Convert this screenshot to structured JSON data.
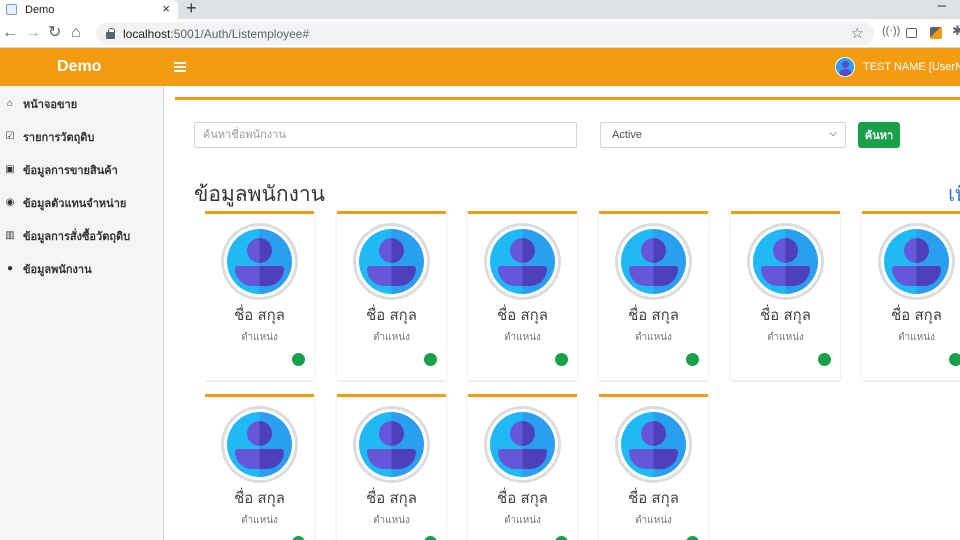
{
  "browser": {
    "tab_title": "Demo",
    "tab_close": "×",
    "new_tab": "+",
    "window_minimize": "–",
    "back": "←",
    "forward": "→",
    "reload": "↻",
    "home": "⌂",
    "url_host": "localhost",
    "url_path": ":5001/Auth/Listemployee#",
    "bookmark": "☆"
  },
  "navbar": {
    "brand": "Demo",
    "user_name": "TEST NAME [UserName]",
    "color": "#f39c12"
  },
  "sidebar": {
    "items": [
      {
        "icon": "home-icon",
        "label": "หน้าจอขาย"
      },
      {
        "icon": "check-square-icon",
        "label": "รายการวัตถุดิบ"
      },
      {
        "icon": "money-icon",
        "label": "ข้อมูลการขายสินค้า"
      },
      {
        "icon": "eye-icon",
        "label": "ข้อมูลตัวแทนจำหน่าย"
      },
      {
        "icon": "bar-chart-icon",
        "label": "ข้อมูลการสั่งซื้อวัตถุดิบ"
      },
      {
        "icon": "user-icon",
        "label": "ข้อมูลพนักงาน"
      }
    ]
  },
  "main": {
    "search_placeholder": "ค้นหาชื่อพนักงาน",
    "status_selected": "Active",
    "search_button": "ค้นหา",
    "section_title": "ข้อมูลพนักงาน",
    "more_link": "เพิ่ม",
    "employees": [
      {
        "name": "ชื่อ สกุล",
        "position": "ตำแหน่ง",
        "status": "active"
      },
      {
        "name": "ชื่อ สกุล",
        "position": "ตำแหน่ง",
        "status": "active"
      },
      {
        "name": "ชื่อ สกุล",
        "position": "ตำแหน่ง",
        "status": "active"
      },
      {
        "name": "ชื่อ สกุล",
        "position": "ตำแหน่ง",
        "status": "active"
      },
      {
        "name": "ชื่อ สกุล",
        "position": "ตำแหน่ง",
        "status": "active"
      },
      {
        "name": "ชื่อ สกุล",
        "position": "ตำแหน่ง",
        "status": "active"
      },
      {
        "name": "ชื่อ สกุล",
        "position": "ตำแหน่ง",
        "status": "active"
      },
      {
        "name": "ชื่อ สกุล",
        "position": "ตำแหน่ง",
        "status": "active"
      },
      {
        "name": "ชื่อ สกุล",
        "position": "ตำแหน่ง",
        "status": "active"
      },
      {
        "name": "ชื่อ สกุล",
        "position": "ตำแหน่ง",
        "status": "active"
      }
    ]
  },
  "colors": {
    "accent": "#f39c12",
    "success": "#19a04b",
    "link": "#3c7fc8"
  }
}
